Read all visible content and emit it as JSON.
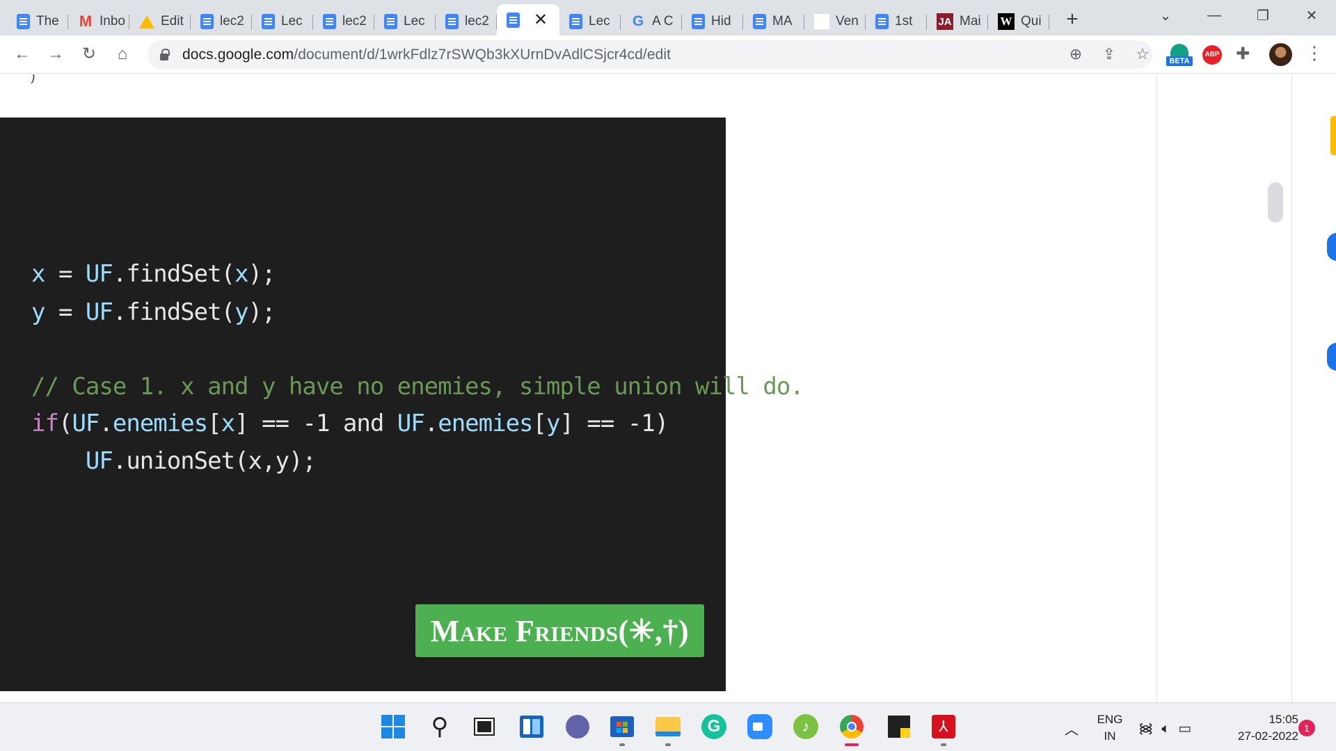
{
  "browser": {
    "tabs": [
      {
        "icon": "docs-icon",
        "title": "The"
      },
      {
        "icon": "gmail-icon",
        "title": "Inbo"
      },
      {
        "icon": "drive-icon",
        "title": "Edit"
      },
      {
        "icon": "docs-icon",
        "title": "lec2"
      },
      {
        "icon": "docs-icon",
        "title": "Lec"
      },
      {
        "icon": "docs-icon",
        "title": "lec2"
      },
      {
        "icon": "docs-icon",
        "title": "Lec"
      },
      {
        "icon": "docs-icon",
        "title": "lec2"
      },
      {
        "icon": "docs-icon",
        "title": "",
        "active": true
      },
      {
        "icon": "docs-icon",
        "title": "Lec"
      },
      {
        "icon": "google-icon",
        "title": "A C"
      },
      {
        "icon": "docs-icon",
        "title": "Hid"
      },
      {
        "icon": "docs-icon",
        "title": "MA"
      },
      {
        "icon": "blank-icon",
        "title": "Ven"
      },
      {
        "icon": "docs-icon",
        "title": "1st"
      },
      {
        "icon": "ja-icon",
        "title": "Mai"
      },
      {
        "icon": "w-icon",
        "title": "Qui"
      }
    ],
    "new_tab": "+",
    "window_controls": {
      "dropdown": "⌄",
      "minimize": "—",
      "restore": "❐",
      "close": "✕"
    },
    "url_host": "docs.google.com",
    "url_path": "/document/d/1wrkFdlz7rSWQb3kXUrnDvAdlCSjcr4cd/edit",
    "extensions": {
      "beta_label": "BETA",
      "abp_label": "ABP"
    }
  },
  "document": {
    "code_lines": [
      [
        {
          "t": "x",
          "c": "var"
        },
        {
          "t": " = ",
          "c": "plain"
        },
        {
          "t": "UF",
          "c": "var"
        },
        {
          "t": ".findSet(",
          "c": "plain"
        },
        {
          "t": "x",
          "c": "var"
        },
        {
          "t": ");",
          "c": "plain"
        }
      ],
      [
        {
          "t": "y",
          "c": "var"
        },
        {
          "t": " = ",
          "c": "plain"
        },
        {
          "t": "UF",
          "c": "var"
        },
        {
          "t": ".findSet(",
          "c": "plain"
        },
        {
          "t": "y",
          "c": "var"
        },
        {
          "t": ");",
          "c": "plain"
        }
      ],
      [
        {
          "t": "// Case 1. x and y have no enemies, simple union will do.",
          "c": "comment"
        }
      ],
      [
        {
          "t": "if",
          "c": "kw"
        },
        {
          "t": "(",
          "c": "plain"
        },
        {
          "t": "UF",
          "c": "var"
        },
        {
          "t": ".",
          "c": "plain"
        },
        {
          "t": "enemies",
          "c": "var"
        },
        {
          "t": "[",
          "c": "plain"
        },
        {
          "t": "x",
          "c": "var"
        },
        {
          "t": "] == -1 and ",
          "c": "plain"
        },
        {
          "t": "UF",
          "c": "var"
        },
        {
          "t": ".",
          "c": "plain"
        },
        {
          "t": "enemies",
          "c": "var"
        },
        {
          "t": "[",
          "c": "plain"
        },
        {
          "t": "y",
          "c": "var"
        },
        {
          "t": "] == -1)",
          "c": "plain"
        }
      ],
      [
        {
          "t": "    ",
          "c": "plain"
        },
        {
          "t": "UF",
          "c": "var"
        },
        {
          "t": ".unionSet(x,y);",
          "c": "plain"
        }
      ]
    ],
    "button_label": "Make Friends(✳,†)"
  },
  "taskbar": {
    "language_line1": "ENG",
    "language_line2": "IN",
    "time": "15:05",
    "date": "27-02-2022",
    "notification_count": "1"
  },
  "colors": {
    "code_background": "#1e1e1e",
    "button_green": "#4caf50",
    "docs_blue": "#4285f4"
  }
}
